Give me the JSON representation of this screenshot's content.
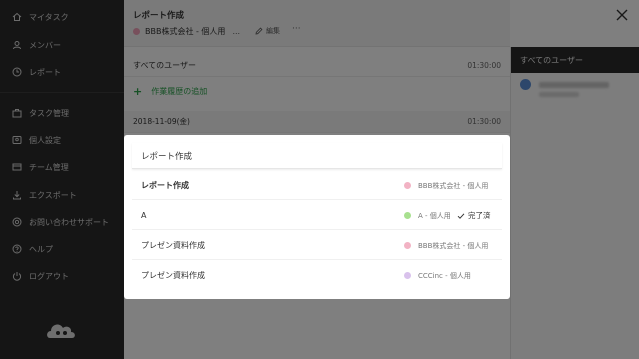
{
  "sidebar": {
    "items": [
      {
        "label": "マイタスク",
        "icon": "home-icon"
      },
      {
        "label": "メンバー",
        "icon": "user-icon"
      },
      {
        "label": "レポート",
        "icon": "report-icon"
      },
      {
        "label": "タスク管理",
        "icon": "briefcase-icon"
      },
      {
        "label": "個人設定",
        "icon": "person-settings-icon"
      },
      {
        "label": "チーム管理",
        "icon": "team-icon"
      },
      {
        "label": "エクスポート",
        "icon": "download-icon"
      },
      {
        "label": "お問い合わせサポート",
        "icon": "help-circle-icon"
      },
      {
        "label": "ヘルプ",
        "icon": "question-icon"
      },
      {
        "label": "ログアウト",
        "icon": "power-icon"
      }
    ]
  },
  "main": {
    "title": "レポート作成",
    "project": {
      "name": "BBB株式会社 - 個人用",
      "ellipsis": "...",
      "color": "#f0a0b8"
    },
    "edit_label": "編集",
    "more_label": "···",
    "users_row": {
      "label": "すべてのユーザー",
      "time": "01:30:00"
    },
    "add_history_label": "作業履歴の追加",
    "date_row": {
      "label": "2018-11-09(金)",
      "time": "01:30:00"
    }
  },
  "users_panel": {
    "header": "すべてのユーザー"
  },
  "modal": {
    "search_value": "レポート作成",
    "options": [
      {
        "label": "レポート作成",
        "bold": true,
        "project": "BBB株式会社 - 個人用",
        "project_color": "#f2b3c4",
        "done": ""
      },
      {
        "label": "A",
        "bold": false,
        "project": "A - 個人用",
        "project_color": "#a8e08f",
        "done": "完了済"
      },
      {
        "label": "プレゼン資料作成",
        "bold": false,
        "project": "BBB株式会社 - 個人用",
        "project_color": "#f2b3c4",
        "done": ""
      },
      {
        "label": "プレゼン資料作成",
        "bold": false,
        "project": "CCCinc - 個人用",
        "project_color": "#d9c2ec",
        "done": ""
      }
    ]
  },
  "colors": {
    "sidebar_bg": "#2b2b2b",
    "accent_green": "#2da24b",
    "overlay": "rgba(0,0,0,0.5)"
  }
}
